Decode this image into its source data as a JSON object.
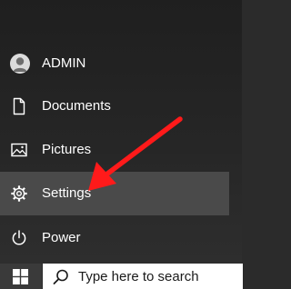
{
  "menu": {
    "items": [
      {
        "label": "ADMIN",
        "icon": "user-avatar-icon"
      },
      {
        "label": "Documents",
        "icon": "document-icon"
      },
      {
        "label": "Pictures",
        "icon": "pictures-icon"
      },
      {
        "label": "Settings",
        "icon": "gear-icon",
        "highlighted": true
      },
      {
        "label": "Power",
        "icon": "power-icon"
      }
    ]
  },
  "taskbar": {
    "start_icon": "windows-logo-icon",
    "search_icon": "search-icon",
    "search_placeholder": "Type here to search"
  },
  "annotation": {
    "arrow_color": "#ff1a1a",
    "points_to": "Settings"
  },
  "colors": {
    "menu_background": "#262626",
    "highlight_background": "#4a4a4a",
    "taskbar_background": "#3a3a3a"
  }
}
